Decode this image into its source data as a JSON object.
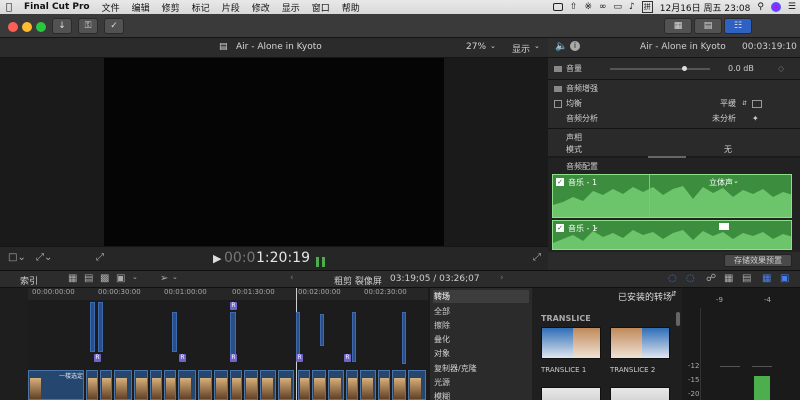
{
  "menubar": {
    "app_name": "Final Cut Pro",
    "items": [
      "文件",
      "编辑",
      "修剪",
      "标记",
      "片段",
      "修改",
      "显示",
      "窗口",
      "帮助"
    ],
    "datetime": "12月16日 周五 23:08"
  },
  "viewer": {
    "title": "Air - Alone in Kyoto",
    "zoom": "27%",
    "display_label": "显示",
    "timecode_dim": "00:0",
    "timecode": "1:20:19"
  },
  "inspector": {
    "title": "Air - Alone in Kyoto",
    "timecode": "00:03:19:10",
    "volume_label": "音量",
    "volume_value": "0.0 dB",
    "enhance_label": "音频增强",
    "eq_label": "均衡",
    "eq_value": "平缓",
    "analysis_label": "音频分析",
    "analysis_value": "未分析",
    "pan_label": "声相",
    "pan_mode_label": "模式",
    "pan_mode_value": "无",
    "audio_config_label": "音频配置",
    "stereo_channel": "音乐 - 1",
    "stereo_value": "立体声",
    "mono_channel": "音乐 - 1",
    "save_preset": "存储效果预置"
  },
  "timeline_header": {
    "index_label": "索引",
    "view_mode": "粗剪 裂像屏",
    "duration": "03:19;05 / 03:26;07"
  },
  "ruler_ticks": [
    "00:00:00:00",
    "00:00:30:00",
    "00:01:00:00",
    "00:01:30:00",
    "00:02:00:00",
    "00:02:30:00"
  ],
  "timeline_clip_title": "一楼选定",
  "markers": [
    "R",
    "R",
    "R",
    "R",
    "R",
    "R"
  ],
  "transitions": {
    "categories": [
      "转场",
      "全部",
      "擦除",
      "叠化",
      "对象",
      "复制器/克隆",
      "光源",
      "模糊"
    ],
    "installed_label": "已安装的转场",
    "group_label": "TRANSLICE",
    "items": [
      "TRANSLICE 1",
      "TRANSLICE 2"
    ]
  },
  "meter": {
    "labels": [
      "-9",
      "-4",
      "-12",
      "-15",
      "-20"
    ]
  },
  "colors": {
    "accent_blue": "#3a6fd8",
    "audio_green": "#5cbf5a",
    "clip_blue": "#2a4f86",
    "marker_purple": "#6f64c9"
  }
}
